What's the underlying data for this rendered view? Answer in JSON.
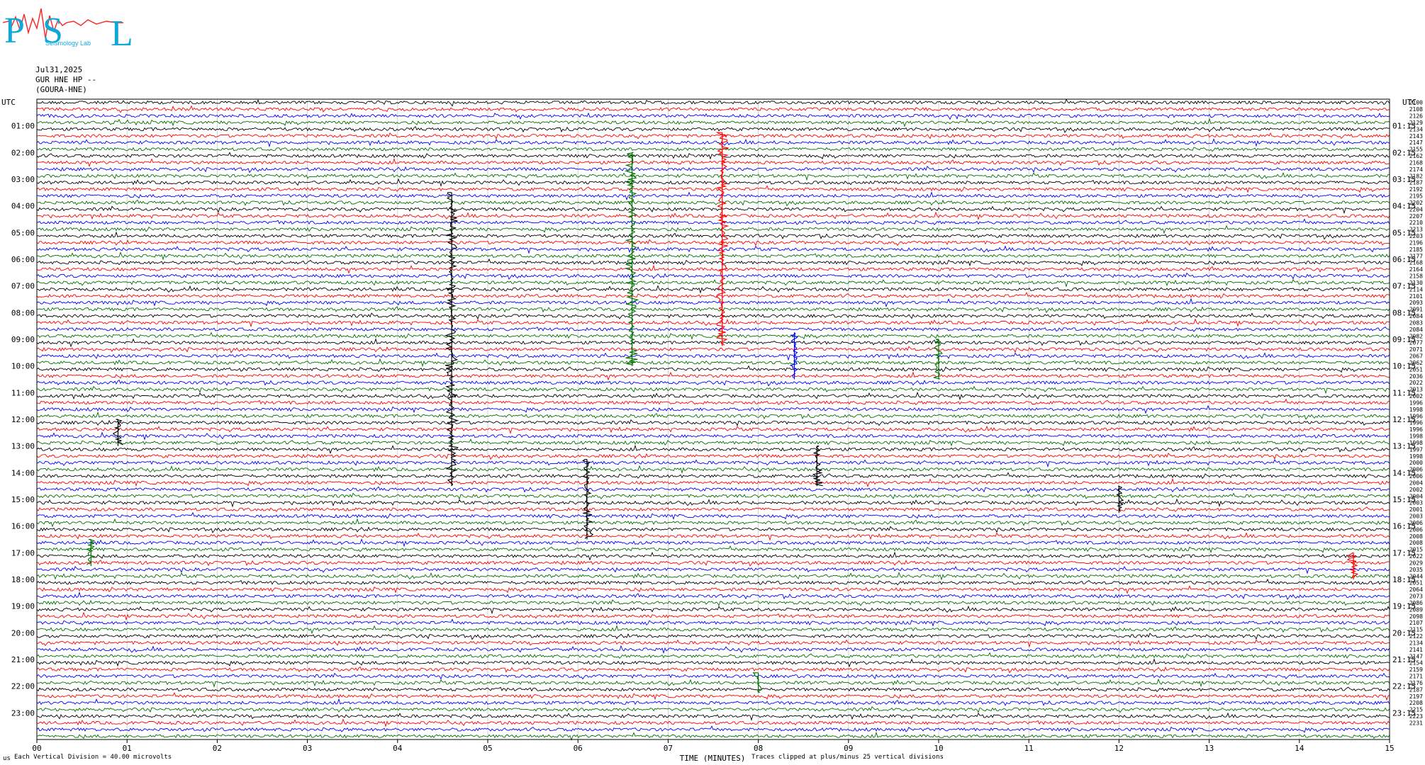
{
  "logo": {
    "letters": [
      "P",
      "S",
      "L"
    ],
    "subtext": "Seismology Lab"
  },
  "header": {
    "date": "Jul31,2025",
    "station": "GUR HNE HP --",
    "location": "(GOURA-HNE)"
  },
  "footer": {
    "division_note": "Each Vertical Division =   40.00 microvolts",
    "clip_note": "Traces clipped at plus/minus 25 vertical divisions"
  },
  "chart_data": {
    "type": "line",
    "title": "",
    "xlabel": "TIME (MINUTES)",
    "ylabel_left": "UTC",
    "ylabel_right": "UTC",
    "xlim": [
      0,
      15
    ],
    "x_ticks": [
      "00",
      "01",
      "02",
      "03",
      "04",
      "05",
      "06",
      "07",
      "08",
      "09",
      "10",
      "11",
      "12",
      "13",
      "14",
      "15"
    ],
    "left_labels": [
      "01:00",
      "02:00",
      "03:00",
      "04:00",
      "05:00",
      "06:00",
      "07:00",
      "08:00",
      "09:00",
      "10:00",
      "11:00",
      "12:00",
      "13:00",
      "14:00",
      "15:00",
      "16:00",
      "17:00",
      "18:00",
      "19:00",
      "20:00",
      "21:00",
      "22:00",
      "23:00"
    ],
    "right_labels": [
      "01:15",
      "02:15",
      "03:15",
      "04:15",
      "05:15",
      "06:15",
      "07:15",
      "08:15",
      "09:15",
      "10:15",
      "11:15",
      "12:15",
      "13:15",
      "14:15",
      "15:15",
      "16:15",
      "17:15",
      "18:15",
      "19:15",
      "20:15",
      "21:15",
      "22:15",
      "23:15"
    ],
    "trace_colors": [
      "#000000",
      "#ff0000",
      "#0000ff",
      "#007000"
    ],
    "trace_count": 96,
    "right_counts": [
      "2100",
      "2108",
      "2126",
      "2129",
      "2134",
      "2143",
      "2147",
      "2155",
      "2162",
      "2168",
      "2174",
      "2182",
      "2187",
      "2192",
      "2195",
      "2202",
      "2204",
      "2207",
      "2210",
      "2213",
      "2203",
      "2196",
      "2185",
      "2177",
      "2168",
      "2164",
      "2158",
      "2130",
      "2114",
      "2101",
      "2093",
      "2091",
      "2084",
      "2083",
      "2084",
      "2082",
      "2077",
      "2071",
      "2067",
      "2062",
      "2051",
      "2036",
      "2022",
      "2013",
      "2002",
      "1996",
      "1998",
      "1996",
      "1996",
      "1996",
      "1998",
      "1998",
      "1997",
      "1998",
      "2000",
      "2006",
      "2006",
      "2004",
      "2002",
      "2004",
      "2003",
      "2001",
      "2003",
      "2006",
      "2006",
      "2008",
      "2008",
      "2015",
      "2022",
      "2029",
      "2035",
      "2044",
      "2051",
      "2064",
      "2073",
      "2086",
      "2089",
      "2098",
      "2107",
      "2115",
      "2122",
      "2134",
      "2141",
      "2147",
      "2154",
      "2159",
      "2171",
      "2176",
      "2187",
      "2197",
      "2208",
      "2215",
      "2223",
      "2231"
    ],
    "events": [
      {
        "minute": 7.6,
        "from_trace": 5,
        "to_trace": 37,
        "color": "#ff0000"
      },
      {
        "minute": 4.6,
        "from_trace": 14,
        "to_trace": 58,
        "color": "#000000"
      },
      {
        "minute": 6.6,
        "from_trace": 8,
        "to_trace": 40,
        "color": "#007000"
      },
      {
        "minute": 8.4,
        "from_trace": 35,
        "to_trace": 42,
        "color": "#0000ff"
      },
      {
        "minute": 0.9,
        "from_trace": 48,
        "to_trace": 52,
        "color": "#000000"
      },
      {
        "minute": 8.65,
        "from_trace": 52,
        "to_trace": 58,
        "color": "#000000"
      },
      {
        "minute": 6.1,
        "from_trace": 54,
        "to_trace": 66,
        "color": "#000000"
      },
      {
        "minute": 12.0,
        "from_trace": 58,
        "to_trace": 62,
        "color": "#000000"
      },
      {
        "minute": 10.0,
        "from_trace": 36,
        "to_trace": 42,
        "color": "#007000"
      },
      {
        "minute": 14.6,
        "from_trace": 68,
        "to_trace": 72,
        "color": "#ff0000"
      },
      {
        "minute": 0.6,
        "from_trace": 66,
        "to_trace": 70,
        "color": "#007000"
      },
      {
        "minute": 8.0,
        "from_trace": 86,
        "to_trace": 89,
        "color": "#007000"
      }
    ]
  }
}
